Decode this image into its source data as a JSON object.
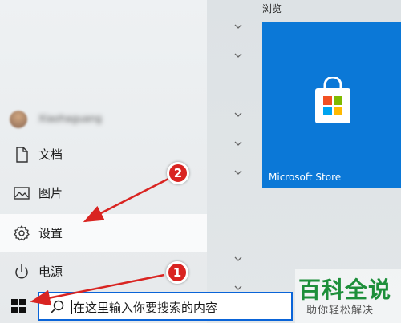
{
  "tiles": {
    "group_header": "浏览",
    "store_label": "Microsoft Store"
  },
  "user": {
    "name": "Xiaohaguang"
  },
  "menu": {
    "documents": "文档",
    "pictures": "图片",
    "settings": "设置",
    "power": "电源"
  },
  "search": {
    "placeholder": "在这里输入你要搜索的内容"
  },
  "annotations": {
    "badge1": "1",
    "badge2": "2"
  },
  "watermark": {
    "title": "百科全说",
    "subtitle": "助你轻松解决"
  },
  "colors": {
    "accent": "#0b78d7",
    "search_border": "#0a64d8",
    "annotation_red": "#d92421",
    "watermark_green": "#1d8f3a"
  }
}
